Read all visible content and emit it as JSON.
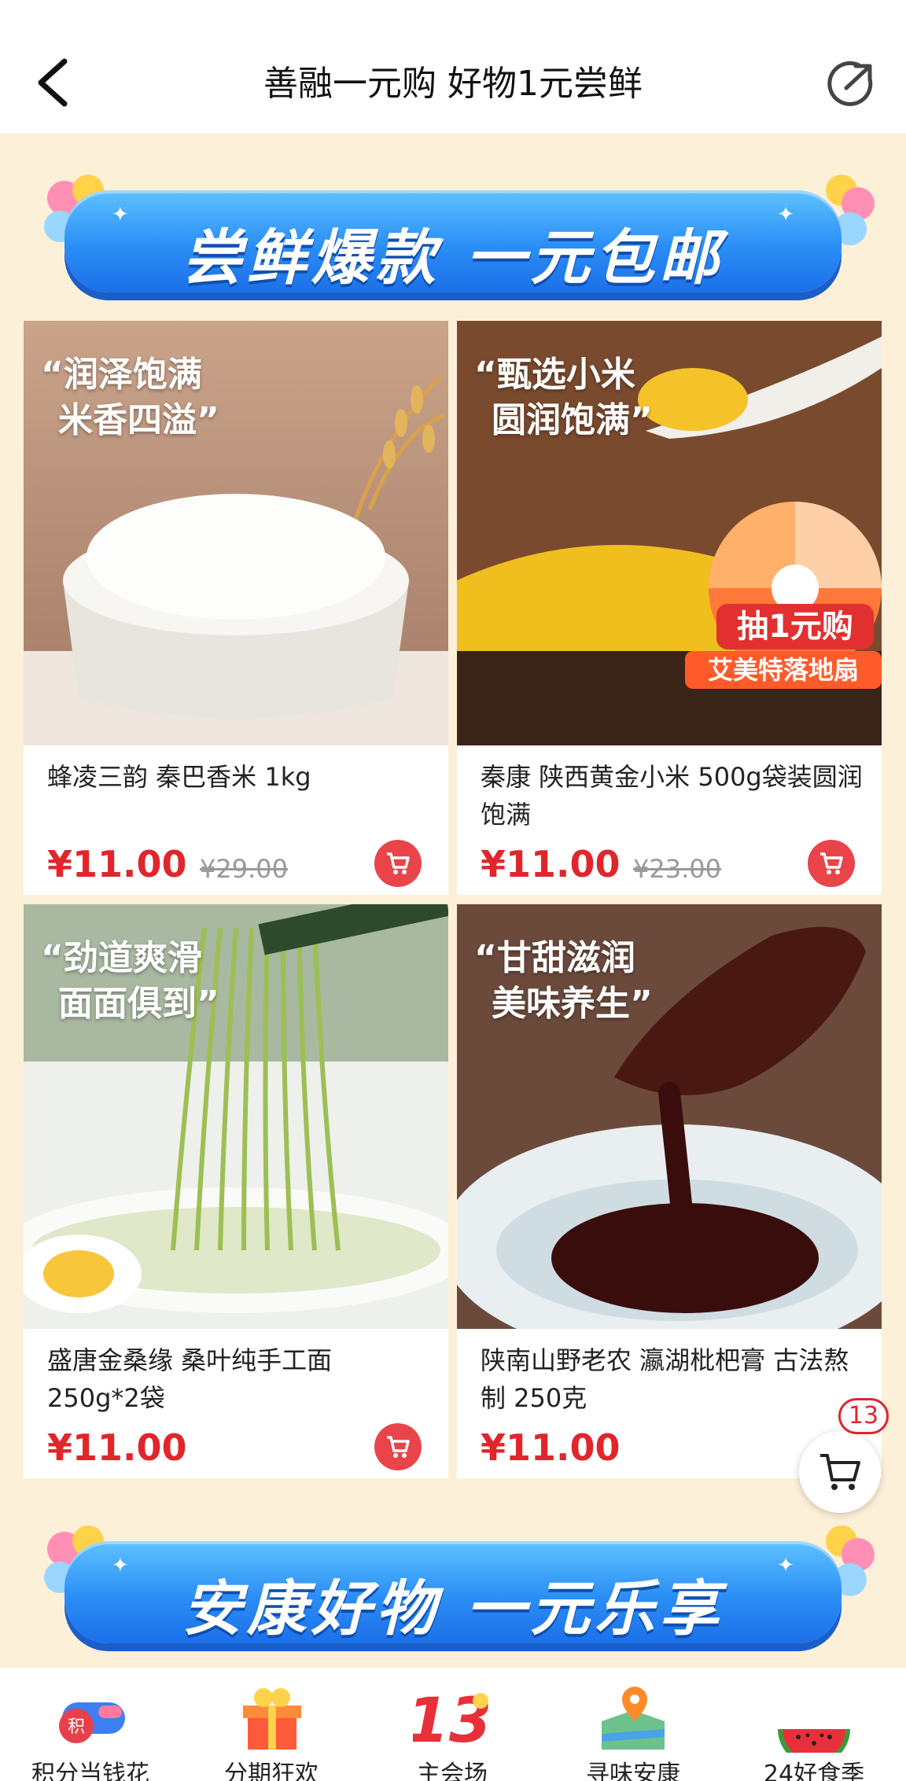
{
  "header": {
    "title": "善融一元购 好物1元尝鲜"
  },
  "banners": [
    {
      "text": "尝鲜爆款 一元包邮"
    },
    {
      "text": "安康好物 一元乐享"
    }
  ],
  "products": [
    {
      "quote1": "“润泽饱满",
      "quote2": "米香四溢”",
      "name": "蜂凌三韵 秦巴香米 1kg",
      "price": "¥11.00",
      "original_price": "¥29.00"
    },
    {
      "quote1": "“甄选小米",
      "quote2": "圆润饱满”",
      "name": "秦康 陕西黄金小米 500g袋装圆润饱满",
      "price": "¥11.00",
      "original_price": "¥23.00",
      "promo1": "抽1元购",
      "promo2": "艾美特落地扇"
    },
    {
      "quote1": "“劲道爽滑",
      "quote2": "面面俱到”",
      "name": "盛唐金桑缘 桑叶纯手工面 250g*2袋",
      "price": "¥11.00"
    },
    {
      "quote1": "“甘甜滋润",
      "quote2": "美味养生”",
      "name": "陕南山野老农 瀛湖枇杷膏 古法熬制 250克",
      "price": "¥11.00"
    }
  ],
  "cart": {
    "count": "13"
  },
  "tabs": [
    {
      "label": "积分当钱花",
      "icon": "points-icon"
    },
    {
      "label": "分期狂欢",
      "icon": "gift-icon"
    },
    {
      "label": "主会场",
      "icon": "anniversary-13-icon"
    },
    {
      "label": "寻味安康",
      "icon": "map-pin-icon"
    },
    {
      "label": "24好食季",
      "icon": "watermelon-icon"
    }
  ],
  "colors": {
    "accent": "#e0262c",
    "banner": "#2b8ef6",
    "background": "#fdf0d8"
  }
}
